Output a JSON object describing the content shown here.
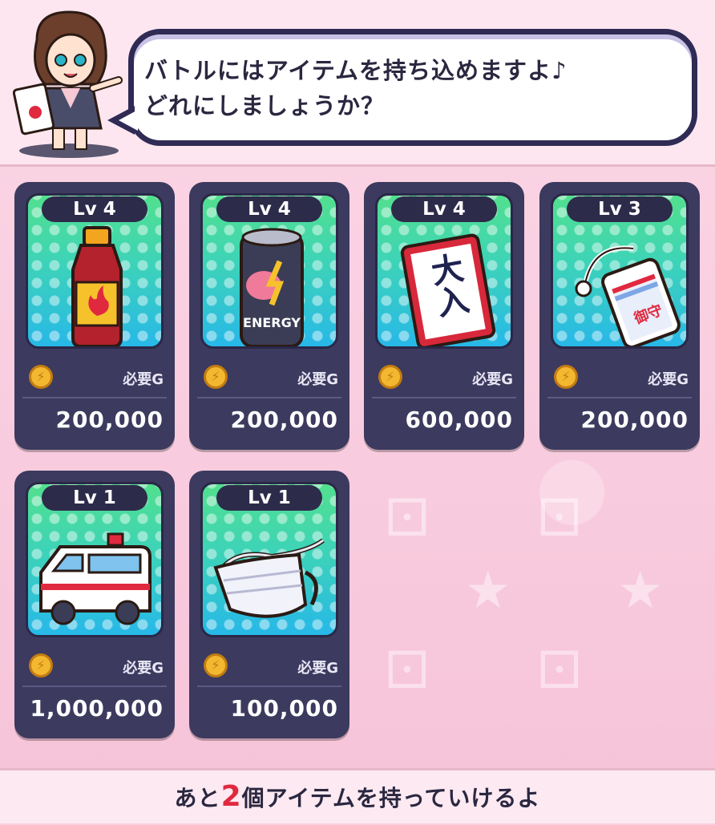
{
  "dialog": {
    "line1": "バトルにはアイテムを持ち込めますよ♪",
    "line2": "どれにしましょうか？"
  },
  "items": [
    {
      "level": "Lv 4",
      "req_label": "必要G",
      "price": "200,000",
      "icon": "energy-drink-bottle-icon"
    },
    {
      "level": "Lv 4",
      "req_label": "必要G",
      "price": "200,000",
      "icon": "energy-can-icon"
    },
    {
      "level": "Lv 4",
      "req_label": "必要G",
      "price": "600,000",
      "icon": "daiiri-card-icon"
    },
    {
      "level": "Lv 3",
      "req_label": "必要G",
      "price": "200,000",
      "icon": "omamori-charm-icon"
    },
    {
      "level": "Lv 1",
      "req_label": "必要G",
      "price": "1,000,000",
      "icon": "ambulance-icon"
    },
    {
      "level": "Lv 1",
      "req_label": "必要G",
      "price": "100,000",
      "icon": "face-mask-icon"
    }
  ],
  "item_art_text": {
    "can_text": "ENERGY",
    "card_text": "大入",
    "charm_text": "御守"
  },
  "footer": {
    "prefix": "あと",
    "count": "2",
    "suffix": "個アイテムを持っていけるよ"
  },
  "colors": {
    "card_bg": "#3c3a5e",
    "accent_red": "#e0293f",
    "coin": "#f3b730"
  }
}
